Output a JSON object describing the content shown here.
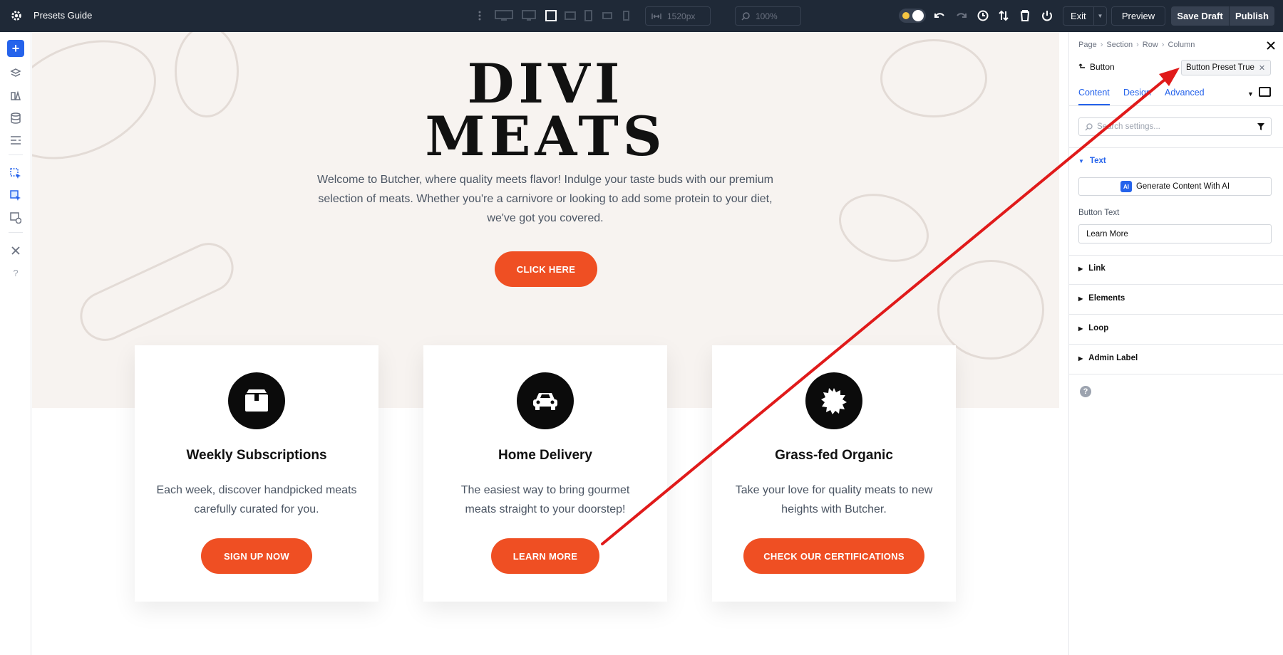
{
  "topbar": {
    "title": "Presets Guide",
    "width_value": "1520px",
    "zoom_value": "100%",
    "exit_label": "Exit",
    "preview_label": "Preview",
    "save_label": "Save Draft",
    "publish_label": "Publish"
  },
  "hero": {
    "brand_line1": "DIVI",
    "brand_line2": "MEATS",
    "intro": "Welcome to Butcher, where quality meets flavor! Indulge your taste buds with our premium selection of meats. Whether you're a carnivore or looking to add some protein to your diet, we've got you covered.",
    "cta_label": "CLICK HERE"
  },
  "cards": [
    {
      "title": "Weekly Subscriptions",
      "text": "Each week, discover handpicked meats carefully curated for you.",
      "button": "SIGN UP NOW",
      "icon": "box-icon"
    },
    {
      "title": "Home Delivery",
      "text": "The easiest way to bring gourmet meats straight to your doorstep!",
      "button": "LEARN MORE",
      "icon": "car-icon"
    },
    {
      "title": "Grass-fed Organic",
      "text": "Take your love for quality meats to new heights with Butcher.",
      "button": "CHECK OUR CERTIFICATIONS",
      "icon": "badge-icon"
    }
  ],
  "panel": {
    "breadcrumbs": [
      "Page",
      "Section",
      "Row",
      "Column"
    ],
    "module_label": "Button",
    "preset_chip": "Button Preset True",
    "tabs": {
      "content": "Content",
      "design": "Design",
      "advanced": "Advanced"
    },
    "search_placeholder": "Search settings...",
    "text_section": "Text",
    "ai_button": "Generate Content With AI",
    "ai_badge": "AI",
    "button_text_label": "Button Text",
    "button_text_value": "Learn More",
    "sections": {
      "link": "Link",
      "elements": "Elements",
      "loop": "Loop",
      "admin": "Admin Label"
    },
    "help_glyph": "?"
  },
  "colors": {
    "accent": "#ef4f23",
    "topbar": "#1f2937",
    "panel_blue": "#2563eb",
    "arrow": "#e01a1a"
  }
}
